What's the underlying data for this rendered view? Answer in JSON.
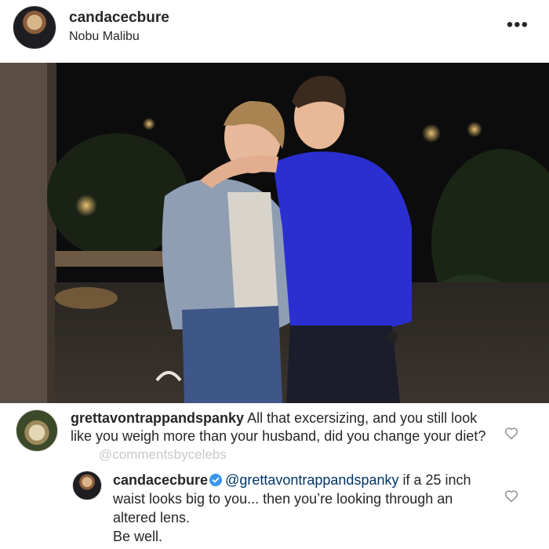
{
  "post": {
    "username": "candacecbure",
    "location": "Nobu Malibu",
    "more_icon": "more-horizontal-icon"
  },
  "comments": [
    {
      "username": "grettavontrappandspanky",
      "text": "All that excersizing, and you still look like you weigh more than your husband, did you change your diet?",
      "watermark": "@commentsbycelebs",
      "icon": "heart-outline-icon"
    },
    {
      "username": "candacecbure",
      "verified": true,
      "mention": "@grettavontrappandspanky",
      "text": "if a 25 inch waist looks big to you... then you’re looking through an altered lens.",
      "closing": "Be well.",
      "icon": "heart-outline-icon"
    }
  ],
  "colors": {
    "text": "#262626",
    "mention": "#003569",
    "verified": "#3897f0",
    "watermark": "#c8c8c8"
  }
}
